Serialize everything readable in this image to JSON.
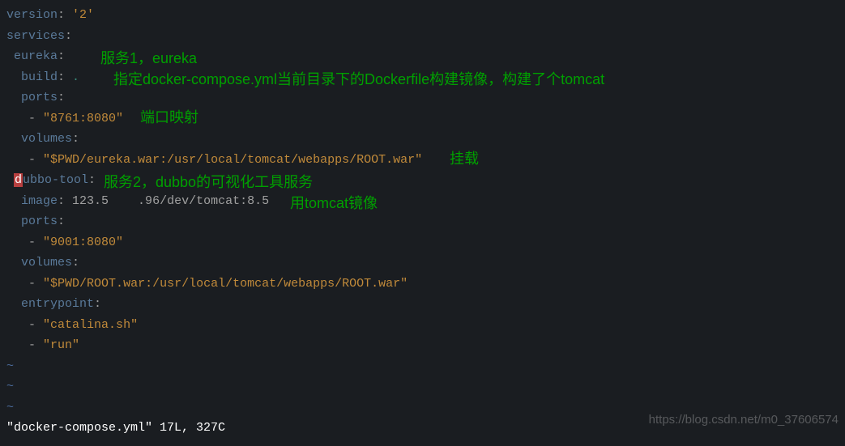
{
  "lines": {
    "l1_key": "version",
    "l1_val": "'2'",
    "l2_key": "services",
    "l3_key": "eureka",
    "l4_key": "build",
    "l4_val": ".",
    "l5_key": "ports",
    "l6_val": "\"8761:8080\"",
    "l7_key": "volumes",
    "l8_val": "\"$PWD/eureka.war:/usr/local/tomcat/webapps/ROOT.war\"",
    "l9_pre": "d",
    "l9_key": "ubbo-tool",
    "l10_key": "image",
    "l10_val": "123.5    .96/dev/tomcat:8.5",
    "l11_key": "ports",
    "l12_val": "\"9001:8080\"",
    "l13_key": "volumes",
    "l14_val": "\"$PWD/ROOT.war:/usr/local/tomcat/webapps/ROOT.war\"",
    "l15_key": "entrypoint",
    "l16_val": "\"catalina.sh\"",
    "l17_val": "\"run\"",
    "tilde": "~"
  },
  "status": "\"docker-compose.yml\" 17L, 327C",
  "annotations": {
    "a1": "服务1，eureka",
    "a2": "指定docker-compose.yml当前目录下的Dockerfile构建镜像，构建了个tomcat",
    "a3": "端口映射",
    "a4": "挂载",
    "a5": "服务2，dubbo的可视化工具服务",
    "a6": "用tomcat镜像"
  },
  "watermark": "https://blog.csdn.net/m0_37606574"
}
